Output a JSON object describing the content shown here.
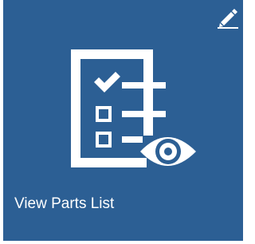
{
  "tile": {
    "label": "View Parts List",
    "icon": "checklist-with-eye-icon",
    "background_color": "#2c5f94",
    "foreground_color": "#ffffff"
  },
  "edit_button": {
    "icon": "pencil-icon"
  }
}
